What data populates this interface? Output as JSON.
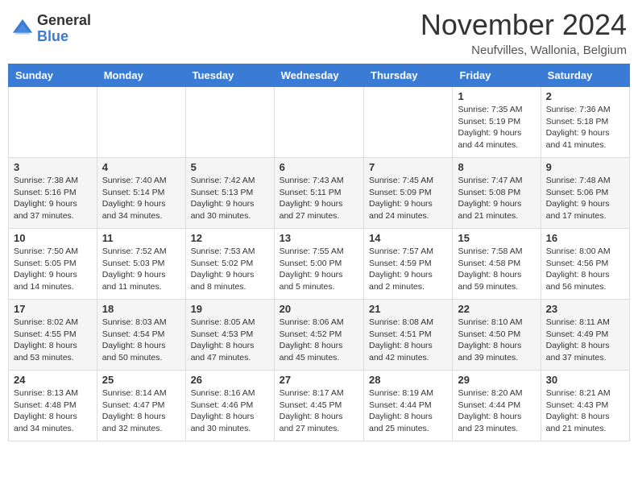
{
  "logo": {
    "general": "General",
    "blue": "Blue"
  },
  "title": "November 2024",
  "location": "Neufvilles, Wallonia, Belgium",
  "headers": [
    "Sunday",
    "Monday",
    "Tuesday",
    "Wednesday",
    "Thursday",
    "Friday",
    "Saturday"
  ],
  "weeks": [
    [
      {
        "day": "",
        "info": ""
      },
      {
        "day": "",
        "info": ""
      },
      {
        "day": "",
        "info": ""
      },
      {
        "day": "",
        "info": ""
      },
      {
        "day": "",
        "info": ""
      },
      {
        "day": "1",
        "info": "Sunrise: 7:35 AM\nSunset: 5:19 PM\nDaylight: 9 hours\nand 44 minutes."
      },
      {
        "day": "2",
        "info": "Sunrise: 7:36 AM\nSunset: 5:18 PM\nDaylight: 9 hours\nand 41 minutes."
      }
    ],
    [
      {
        "day": "3",
        "info": "Sunrise: 7:38 AM\nSunset: 5:16 PM\nDaylight: 9 hours\nand 37 minutes."
      },
      {
        "day": "4",
        "info": "Sunrise: 7:40 AM\nSunset: 5:14 PM\nDaylight: 9 hours\nand 34 minutes."
      },
      {
        "day": "5",
        "info": "Sunrise: 7:42 AM\nSunset: 5:13 PM\nDaylight: 9 hours\nand 30 minutes."
      },
      {
        "day": "6",
        "info": "Sunrise: 7:43 AM\nSunset: 5:11 PM\nDaylight: 9 hours\nand 27 minutes."
      },
      {
        "day": "7",
        "info": "Sunrise: 7:45 AM\nSunset: 5:09 PM\nDaylight: 9 hours\nand 24 minutes."
      },
      {
        "day": "8",
        "info": "Sunrise: 7:47 AM\nSunset: 5:08 PM\nDaylight: 9 hours\nand 21 minutes."
      },
      {
        "day": "9",
        "info": "Sunrise: 7:48 AM\nSunset: 5:06 PM\nDaylight: 9 hours\nand 17 minutes."
      }
    ],
    [
      {
        "day": "10",
        "info": "Sunrise: 7:50 AM\nSunset: 5:05 PM\nDaylight: 9 hours\nand 14 minutes."
      },
      {
        "day": "11",
        "info": "Sunrise: 7:52 AM\nSunset: 5:03 PM\nDaylight: 9 hours\nand 11 minutes."
      },
      {
        "day": "12",
        "info": "Sunrise: 7:53 AM\nSunset: 5:02 PM\nDaylight: 9 hours\nand 8 minutes."
      },
      {
        "day": "13",
        "info": "Sunrise: 7:55 AM\nSunset: 5:00 PM\nDaylight: 9 hours\nand 5 minutes."
      },
      {
        "day": "14",
        "info": "Sunrise: 7:57 AM\nSunset: 4:59 PM\nDaylight: 9 hours\nand 2 minutes."
      },
      {
        "day": "15",
        "info": "Sunrise: 7:58 AM\nSunset: 4:58 PM\nDaylight: 8 hours\nand 59 minutes."
      },
      {
        "day": "16",
        "info": "Sunrise: 8:00 AM\nSunset: 4:56 PM\nDaylight: 8 hours\nand 56 minutes."
      }
    ],
    [
      {
        "day": "17",
        "info": "Sunrise: 8:02 AM\nSunset: 4:55 PM\nDaylight: 8 hours\nand 53 minutes."
      },
      {
        "day": "18",
        "info": "Sunrise: 8:03 AM\nSunset: 4:54 PM\nDaylight: 8 hours\nand 50 minutes."
      },
      {
        "day": "19",
        "info": "Sunrise: 8:05 AM\nSunset: 4:53 PM\nDaylight: 8 hours\nand 47 minutes."
      },
      {
        "day": "20",
        "info": "Sunrise: 8:06 AM\nSunset: 4:52 PM\nDaylight: 8 hours\nand 45 minutes."
      },
      {
        "day": "21",
        "info": "Sunrise: 8:08 AM\nSunset: 4:51 PM\nDaylight: 8 hours\nand 42 minutes."
      },
      {
        "day": "22",
        "info": "Sunrise: 8:10 AM\nSunset: 4:50 PM\nDaylight: 8 hours\nand 39 minutes."
      },
      {
        "day": "23",
        "info": "Sunrise: 8:11 AM\nSunset: 4:49 PM\nDaylight: 8 hours\nand 37 minutes."
      }
    ],
    [
      {
        "day": "24",
        "info": "Sunrise: 8:13 AM\nSunset: 4:48 PM\nDaylight: 8 hours\nand 34 minutes."
      },
      {
        "day": "25",
        "info": "Sunrise: 8:14 AM\nSunset: 4:47 PM\nDaylight: 8 hours\nand 32 minutes."
      },
      {
        "day": "26",
        "info": "Sunrise: 8:16 AM\nSunset: 4:46 PM\nDaylight: 8 hours\nand 30 minutes."
      },
      {
        "day": "27",
        "info": "Sunrise: 8:17 AM\nSunset: 4:45 PM\nDaylight: 8 hours\nand 27 minutes."
      },
      {
        "day": "28",
        "info": "Sunrise: 8:19 AM\nSunset: 4:44 PM\nDaylight: 8 hours\nand 25 minutes."
      },
      {
        "day": "29",
        "info": "Sunrise: 8:20 AM\nSunset: 4:44 PM\nDaylight: 8 hours\nand 23 minutes."
      },
      {
        "day": "30",
        "info": "Sunrise: 8:21 AM\nSunset: 4:43 PM\nDaylight: 8 hours\nand 21 minutes."
      }
    ]
  ]
}
